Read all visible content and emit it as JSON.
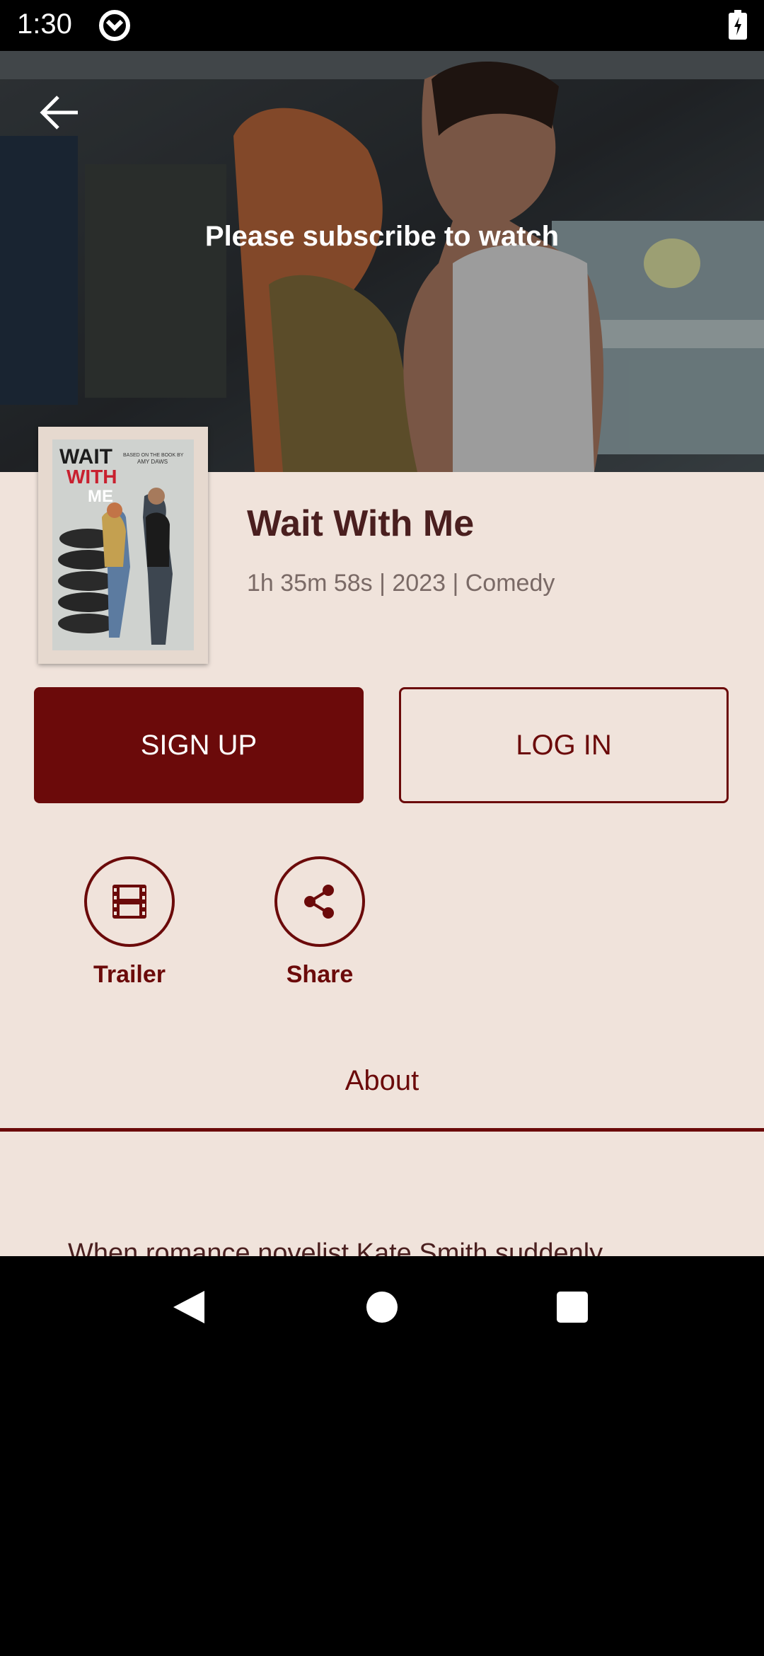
{
  "status_bar": {
    "time": "1:30"
  },
  "hero": {
    "subscribe_message": "Please subscribe to watch"
  },
  "poster": {
    "title_line1": "WAIT",
    "title_line2": "WITH",
    "title_line3": "ME",
    "tagline": "BASED ON THE BOOK BY",
    "author": "AMY DAWS"
  },
  "movie": {
    "title": "Wait With Me",
    "meta": "1h 35m 58s | 2023 | Comedy"
  },
  "buttons": {
    "signup": "SIGN UP",
    "login": "LOG IN"
  },
  "actions": {
    "trailer": "Trailer",
    "share": "Share"
  },
  "tabs": {
    "about": "About"
  },
  "description": "When romance novelist Kate Smith suddenly",
  "colors": {
    "accent": "#6b0a0a",
    "background": "#f0e3db",
    "title": "#4a1f1f"
  },
  "icons": [
    "back-arrow-icon",
    "film-icon",
    "share-icon",
    "nav-back-icon",
    "nav-home-icon",
    "nav-recent-icon"
  ]
}
